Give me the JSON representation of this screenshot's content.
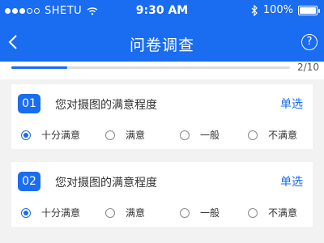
{
  "status_bar": {
    "carrier": "SHETU",
    "time": "9:30 AM",
    "battery": "100%"
  },
  "nav": {
    "title": "问卷调查",
    "help_icon": "?"
  },
  "progress": {
    "label": "2/10",
    "value": 0.2
  },
  "questions": [
    {
      "number": "01",
      "text": "您对摄图的满意程度",
      "type": "单选",
      "options": [
        "十分满意",
        "满意",
        "一般",
        "不满意"
      ],
      "selected": 0
    },
    {
      "number": "02",
      "text": "您对摄图的满意程度",
      "type": "单选",
      "options": [
        "十分满意",
        "满意",
        "一般",
        "不满意"
      ],
      "selected": 0
    }
  ],
  "colors": {
    "accent": "#1a6cf0",
    "background": "#f2f2f2"
  }
}
